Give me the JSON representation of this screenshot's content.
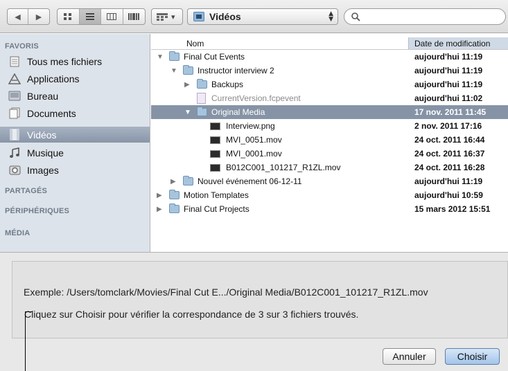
{
  "toolbar": {
    "back_icon": "◀",
    "forward_icon": "▶",
    "view_icons": [
      "icon-view",
      "list-view",
      "column-view",
      "coverflow-view"
    ],
    "arrange_icon": "arrange-icon",
    "arrange_caret": "▾",
    "location": "Vidéos",
    "search_placeholder": ""
  },
  "sidebar": {
    "sections": [
      "FAVORIS",
      "PARTAGÉS",
      "PÉRIPHÉRIQUES",
      "MÉDIA"
    ],
    "items": [
      {
        "label": "Tous mes fichiers",
        "icon": "all-files-icon"
      },
      {
        "label": "Applications",
        "icon": "applications-icon"
      },
      {
        "label": "Bureau",
        "icon": "desktop-icon"
      },
      {
        "label": "Documents",
        "icon": "documents-icon"
      },
      {
        "label": "Vidéos",
        "icon": "movies-icon",
        "selected": true
      },
      {
        "label": "Musique",
        "icon": "music-icon"
      },
      {
        "label": "Images",
        "icon": "pictures-icon"
      }
    ]
  },
  "file_list": {
    "columns": {
      "name": "Nom",
      "date": "Date de modification"
    },
    "rows": [
      {
        "name": "Final Cut Events",
        "date": "aujourd'hui 11:19",
        "indent": 0,
        "kind": "folder",
        "expanded": true
      },
      {
        "name": "Instructor interview 2",
        "date": "aujourd'hui 11:19",
        "indent": 1,
        "kind": "folder",
        "expanded": true
      },
      {
        "name": "Backups",
        "date": "aujourd'hui 11:19",
        "indent": 2,
        "kind": "folder",
        "expanded": false
      },
      {
        "name": "CurrentVersion.fcpevent",
        "date": "aujourd'hui 11:02",
        "indent": 2,
        "kind": "doc",
        "dimmed": true
      },
      {
        "name": "Original Media",
        "date": "17 nov. 2011 11:45",
        "indent": 2,
        "kind": "folder",
        "expanded": true,
        "selected": true
      },
      {
        "name": "Interview.png",
        "date": "2 nov. 2011 17:16",
        "indent": 3,
        "kind": "file"
      },
      {
        "name": "MVI_0051.mov",
        "date": "24 oct. 2011 16:44",
        "indent": 3,
        "kind": "file"
      },
      {
        "name": "MVI_0001.mov",
        "date": "24 oct. 2011 16:37",
        "indent": 3,
        "kind": "file"
      },
      {
        "name": "B012C001_101217_R1ZL.mov",
        "date": "24 oct. 2011 16:28",
        "indent": 3,
        "kind": "file"
      },
      {
        "name": "Nouvel événement 06-12-11",
        "date": "aujourd'hui 11:19",
        "indent": 1,
        "kind": "folder",
        "expanded": false
      },
      {
        "name": "Motion Templates",
        "date": "aujourd'hui 10:59",
        "indent": 0,
        "kind": "folder",
        "expanded": false
      },
      {
        "name": "Final Cut Projects",
        "date": "15 mars 2012 15:51",
        "indent": 0,
        "kind": "folder",
        "expanded": false
      }
    ]
  },
  "info": {
    "example": "Exemple: /Users/tomclark/Movies/Final Cut E.../Original Media/B012C001_101217_R1ZL.mov",
    "message": "Cliquez sur Choisir pour vérifier la correspondance de 3 sur 3 fichiers trouvés."
  },
  "buttons": {
    "cancel": "Annuler",
    "choose": "Choisir"
  }
}
